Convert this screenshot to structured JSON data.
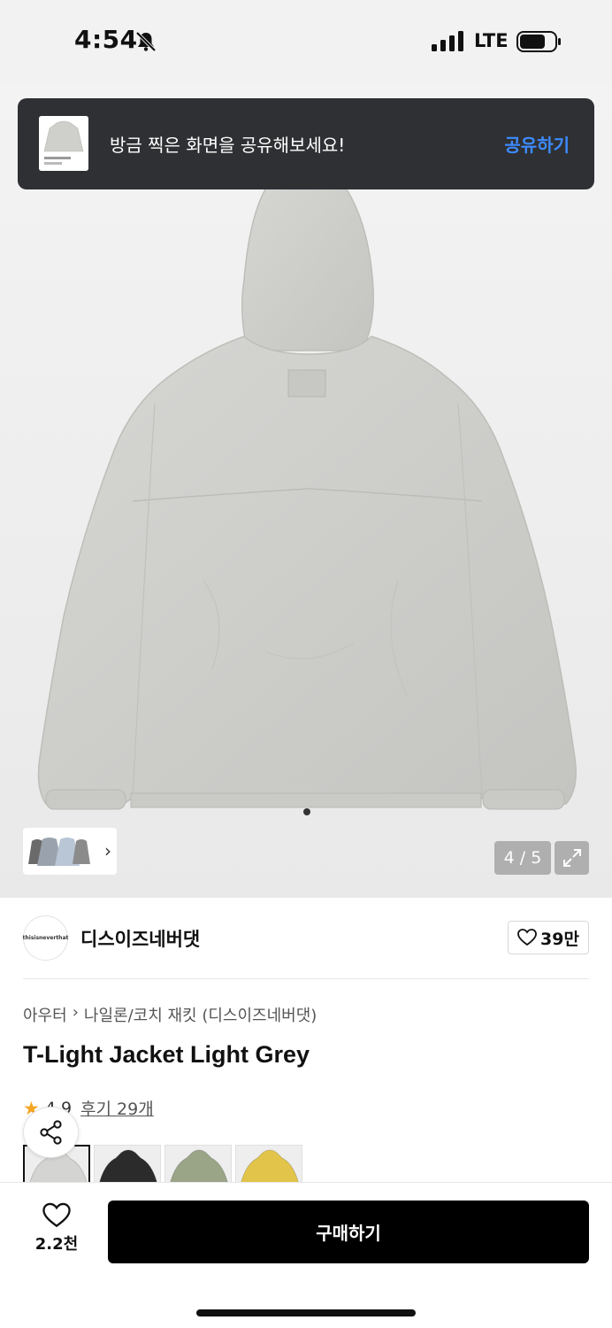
{
  "status_bar": {
    "time": "4:54",
    "network": "LTE"
  },
  "toast": {
    "message": "방금 찍은 화면을 공유해보세요!",
    "action": "공유하기"
  },
  "gallery": {
    "page_counter": "4 / 5",
    "current_page": 4,
    "total_pages": 5
  },
  "brand": {
    "logo_text": "thisisneverthat",
    "name": "디스이즈네버댓",
    "likes": "39만"
  },
  "product": {
    "breadcrumb": [
      "아우터",
      "나일론/코치 재킷 (디스이즈네버댓)"
    ],
    "title": "T-Light Jacket Light Grey",
    "rating": "4.9",
    "reviews": "후기 29개"
  },
  "swatches": [
    {
      "name": "Light Grey",
      "color": "#d4d4d2",
      "selected": true
    },
    {
      "name": "Black",
      "color": "#2b2b2b",
      "selected": false
    },
    {
      "name": "Olive",
      "color": "#9aa487",
      "selected": false
    },
    {
      "name": "Yellow",
      "color": "#e2c44a",
      "selected": false
    }
  ],
  "bottom_bar": {
    "wish_count": "2.2천",
    "buy_label": "구매하기"
  },
  "colors": {
    "toast_bg": "#2f3033",
    "toast_action": "#3d8bff",
    "buy_bg": "#000000",
    "star": "#f5a623"
  }
}
